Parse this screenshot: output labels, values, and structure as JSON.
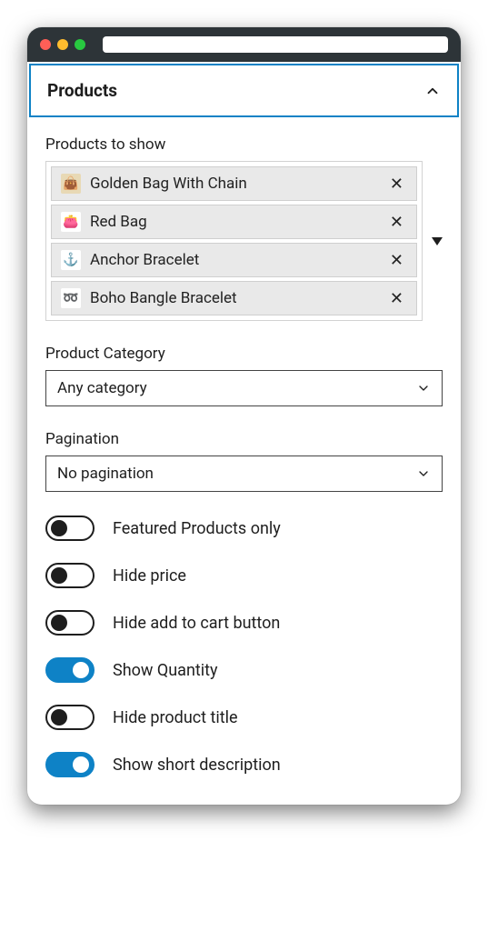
{
  "header": {
    "title": "Products"
  },
  "products_to_show": {
    "label": "Products to show",
    "items": [
      {
        "name": "Golden Bag With Chain",
        "icon": "👜",
        "cls": "bag1"
      },
      {
        "name": "Red Bag",
        "icon": "👛",
        "cls": "bag2"
      },
      {
        "name": "Anchor Bracelet",
        "icon": "⚓",
        "cls": "brace1"
      },
      {
        "name": "Boho Bangle Bracelet",
        "icon": "➿",
        "cls": "brace2"
      }
    ]
  },
  "product_category": {
    "label": "Product Category",
    "value": "Any category"
  },
  "pagination": {
    "label": "Pagination",
    "value": "No pagination"
  },
  "toggles": [
    {
      "label": "Featured Products only",
      "on": false
    },
    {
      "label": "Hide price",
      "on": false
    },
    {
      "label": "Hide add to cart button",
      "on": false
    },
    {
      "label": "Show Quantity",
      "on": true
    },
    {
      "label": "Hide product title",
      "on": false
    },
    {
      "label": "Show short description",
      "on": true
    }
  ]
}
